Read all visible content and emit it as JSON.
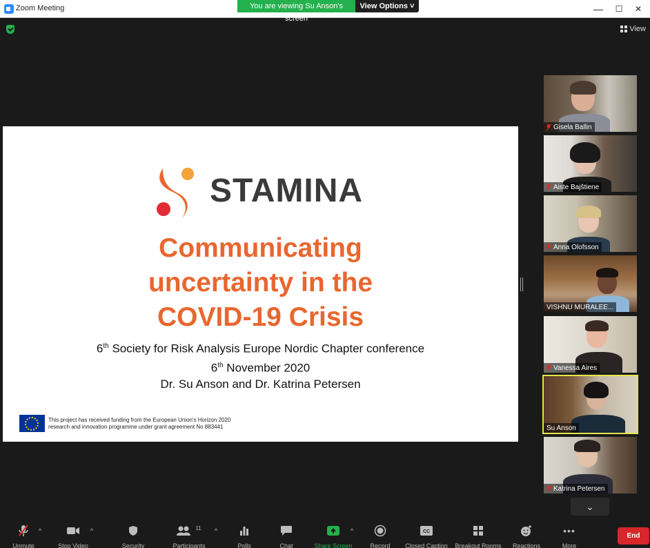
{
  "window": {
    "title": "Zoom Meeting",
    "minimize": "—",
    "maximize": "☐",
    "close": "✕"
  },
  "banner": {
    "viewing": "You are viewing Su Anson's screen",
    "view_options": "View Options ˅"
  },
  "view_toggle": {
    "label": "View"
  },
  "slide": {
    "logo": "STAMINA",
    "title_lines": [
      "Communicating",
      "uncertainty in the",
      "COVID-19 Crisis"
    ],
    "sub_line1_num": "6",
    "sub_line1_sup": "th",
    "sub_line1_rest": " Society for Risk Analysis Europe Nordic Chapter conference",
    "sub_line2_num": "6",
    "sub_line2_sup": "th",
    "sub_line2_rest": " November 2020",
    "sub_line3": "Dr. Su Anson and Dr. Katrina Petersen",
    "eu_line1": "This project has received funding from the European Union's Horizon 2020",
    "eu_line2": "research and innovation programme under grant agreement No 883441"
  },
  "participants": [
    {
      "name": "Gisela Ballin",
      "muted": true
    },
    {
      "name": "Aiste Bajštiene",
      "muted": true
    },
    {
      "name": "Anna Olofsson",
      "muted": true
    },
    {
      "name": "VISHNU MURALEE...",
      "muted": false
    },
    {
      "name": "Vanessa Aires",
      "muted": true
    },
    {
      "name": "Su Anson",
      "muted": false
    },
    {
      "name": "Katrina Petersen",
      "muted": true
    }
  ],
  "toolbar": {
    "unmute": "Unmute",
    "stop_video": "Stop Video",
    "security": "Security",
    "participants": "Participants",
    "participant_count": "11",
    "polls": "Polls",
    "chat": "Chat",
    "share_screen": "Share Screen",
    "record": "Record",
    "closed_caption": "Closed Caption",
    "breakout_rooms": "Breakout Rooms",
    "reactions": "Reactions",
    "more": "More",
    "end": "End"
  },
  "colors": {
    "accent_orange": "#e8672f",
    "share_green": "#23b14d",
    "end_red": "#d8262a",
    "active_speaker": "#e6e64a"
  }
}
